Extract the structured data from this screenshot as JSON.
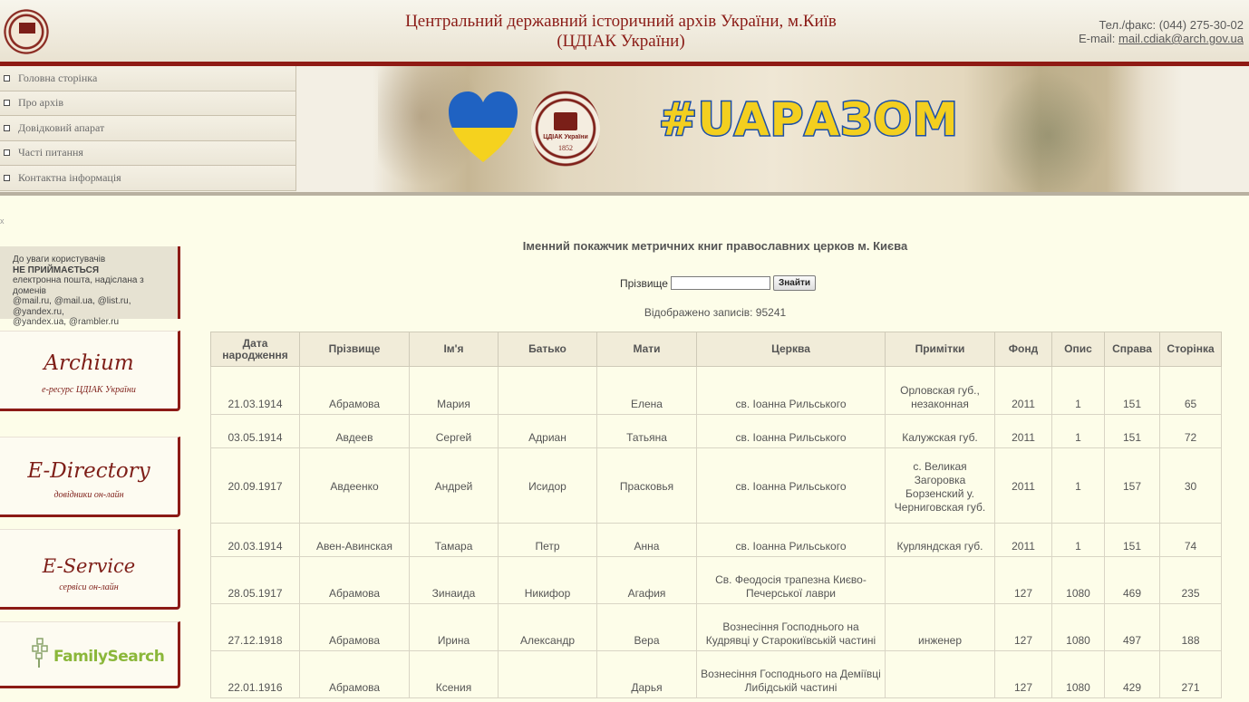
{
  "header": {
    "title_line1": "Центральний державний історичний архів України, м.Київ",
    "title_line2": "(ЦДІАК України)",
    "phone": "Тел./факс: (044) 275-30-02",
    "email_label": "E-mail: ",
    "email": "mail.cdiak@arch.gov.ua"
  },
  "menu": {
    "items": [
      {
        "label": "Головна сторінка"
      },
      {
        "label": "Про архів"
      },
      {
        "label": "Довідковий апарат"
      },
      {
        "label": "Часті питання"
      },
      {
        "label": "Контактна інформація"
      }
    ]
  },
  "banner": {
    "hashtag": "#UAРАЗОМ",
    "seal_text": "ЦДІАК України",
    "seal_year": "1852",
    "logo_text": "ЦДІАК України"
  },
  "sidebar": {
    "tiny_mark": "x",
    "notice_line1": "До уваги користувачів",
    "notice_line2": "НЕ ПРИЙМАЄТЬСЯ",
    "notice_line3": "електронна пошта, надіслана з доменів",
    "notice_line4": "@mail.ru, @mail.ua, @list.ru, @yandex.ru,",
    "notice_line5": "@yandex.ua, @rambler.ru",
    "archium_title": "Archium",
    "archium_sub": "е-ресурс ЦДІАК України",
    "edirectory_title": "E-Directory",
    "edirectory_sub": "довідники он-лайн",
    "eservice_title": "E-Service",
    "eservice_sub": "сервіси он-лайн",
    "familysearch": "FamilySearch"
  },
  "main": {
    "title": "Іменний покажчик метричних книг православних церков м. Києва",
    "search_label": "Прізвище",
    "search_value": "",
    "search_button": "Знайти",
    "count_text": "Відображено записів: 95241"
  },
  "table": {
    "headers": [
      "Дата народження",
      "Прізвище",
      "Ім'я",
      "Батько",
      "Мати",
      "Церква",
      "Примітки",
      "Фонд",
      "Опис",
      "Справа",
      "Сторінка"
    ],
    "rows": [
      [
        "21.03.1914",
        "Абрамова",
        "Мария",
        "",
        "Елена",
        "св. Іоанна Рильського",
        "Орловская губ., незаконная",
        "2011",
        "1",
        "151",
        "65"
      ],
      [
        "03.05.1914",
        "Авдеев",
        "Сергей",
        "Адриан",
        "Татьяна",
        "св. Іоанна Рильського",
        "Калужская губ.",
        "2011",
        "1",
        "151",
        "72"
      ],
      [
        "20.09.1917",
        "Авдеенко",
        "Андрей",
        "Исидор",
        "Прасковья",
        "св. Іоанна Рильського",
        "с. Великая Загоровка Борзенский у. Черниговская губ.",
        "2011",
        "1",
        "157",
        "30"
      ],
      [
        "20.03.1914",
        "Авен-Авинская",
        "Тамара",
        "Петр",
        "Анна",
        "св. Іоанна Рильського",
        "Курляндская губ.",
        "2011",
        "1",
        "151",
        "74"
      ],
      [
        "28.05.1917",
        "Абрамова",
        "Зинаида",
        "Никифор",
        "Агафия",
        "Св. Феодосія трапезна Києво-Печерської лаври",
        "",
        "127",
        "1080",
        "469",
        "235"
      ],
      [
        "27.12.1918",
        "Абрамова",
        "Ирина",
        "Александр",
        "Вера",
        "Вознесіння Господнього на Кудрявці у Старокиївській частині",
        "инженер",
        "127",
        "1080",
        "497",
        "188"
      ],
      [
        "22.01.1916",
        "Абрамова",
        "Ксения",
        "",
        "Дарья",
        "Вознесіння Господнього на Демiївцi Либідській частині",
        "",
        "127",
        "1080",
        "429",
        "271"
      ]
    ]
  },
  "colors": {
    "accent": "#8f1a14",
    "background": "#fdfde9",
    "familysearch_green": "#8bb73a",
    "hashtag_yellow": "#f3cf1f",
    "hashtag_blue": "#1c4fa8"
  }
}
